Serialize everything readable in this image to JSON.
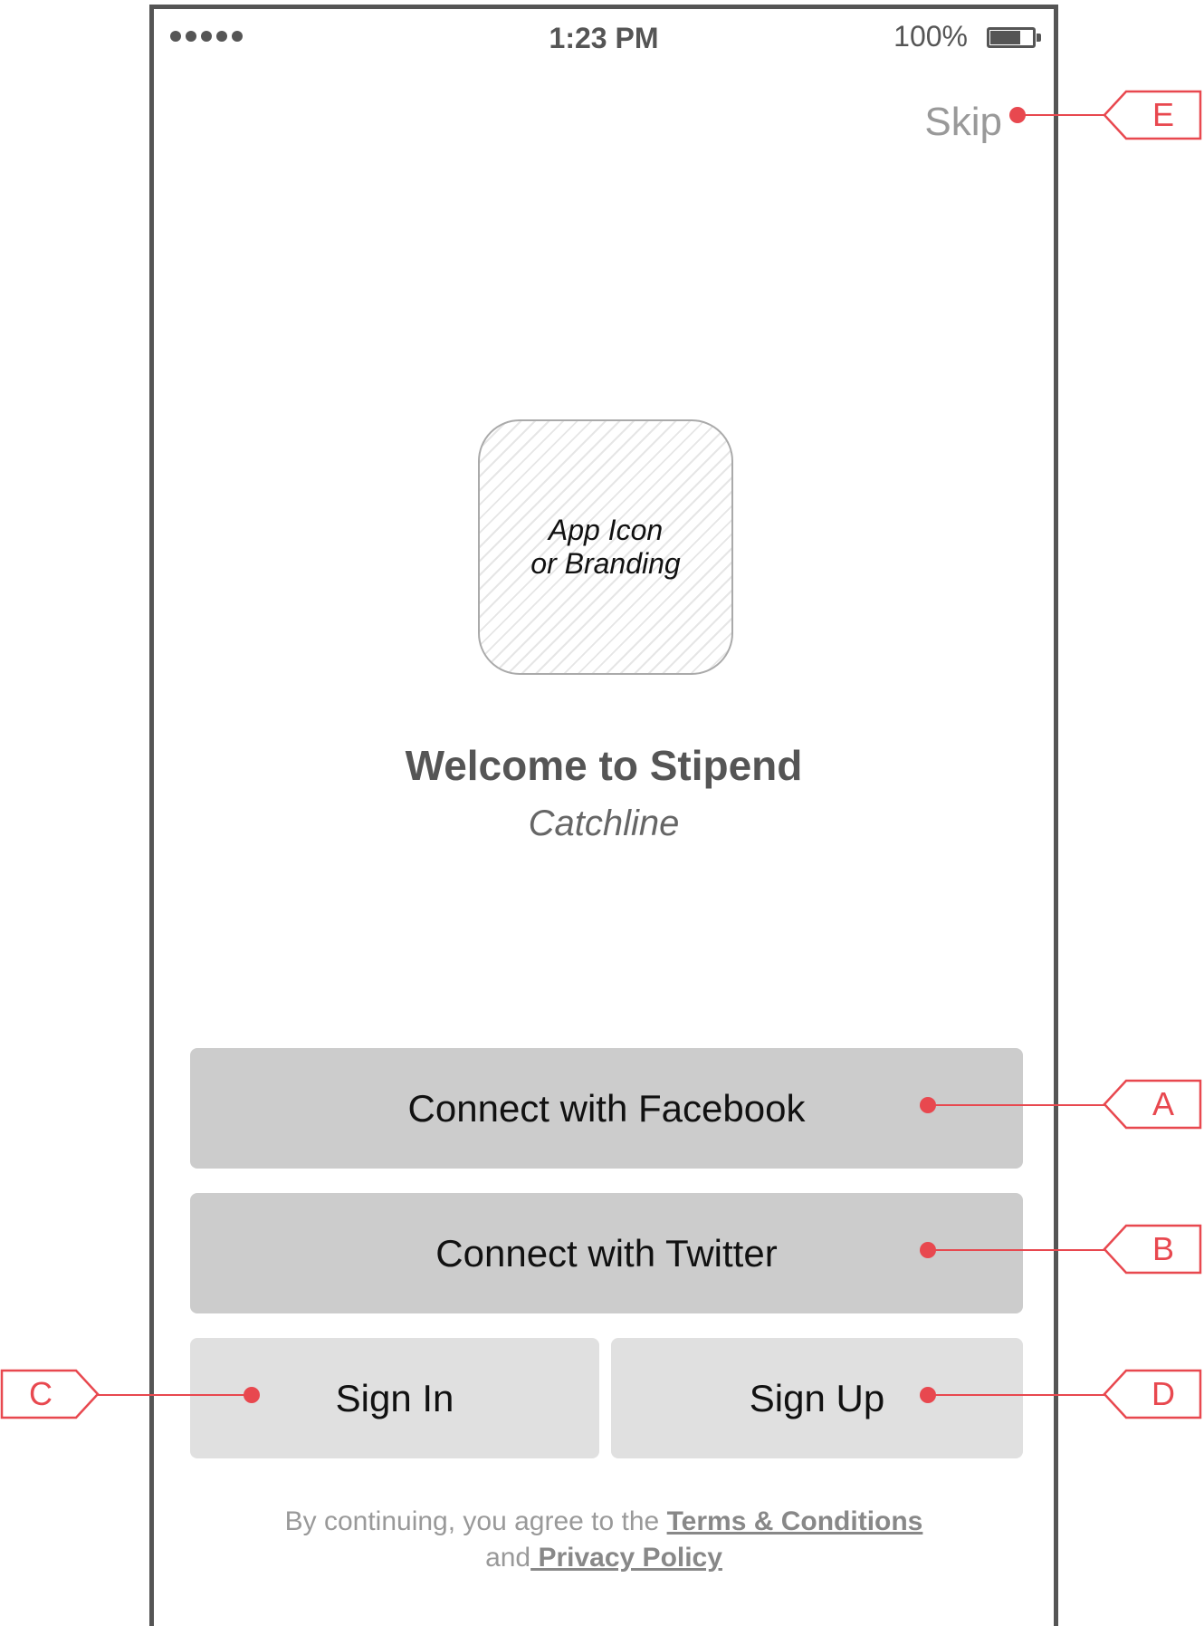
{
  "status_bar": {
    "time": "1:23 PM",
    "battery_percent": "100%",
    "signal_bars": 5
  },
  "header": {
    "skip_label": "Skip"
  },
  "branding": {
    "icon_placeholder": "App Icon\nor Branding",
    "title": "Welcome to Stipend",
    "catchline": "Catchline"
  },
  "actions": {
    "facebook_label": "Connect with Facebook",
    "twitter_label": "Connect with Twitter",
    "signin_label": "Sign In",
    "signup_label": "Sign Up"
  },
  "legal": {
    "prefix": "By continuing, you agree to the ",
    "terms_link": "Terms & Conditions",
    "conjunction": "and",
    "privacy_link": " Privacy Policy"
  },
  "annotations": {
    "a": "A",
    "b": "B",
    "c": "C",
    "d": "D",
    "e": "E",
    "color": "#e8484f"
  },
  "colors": {
    "frame": "#555555",
    "button_dark": "#cccccc",
    "button_light": "#e0e0e0",
    "muted_text": "#999999"
  }
}
